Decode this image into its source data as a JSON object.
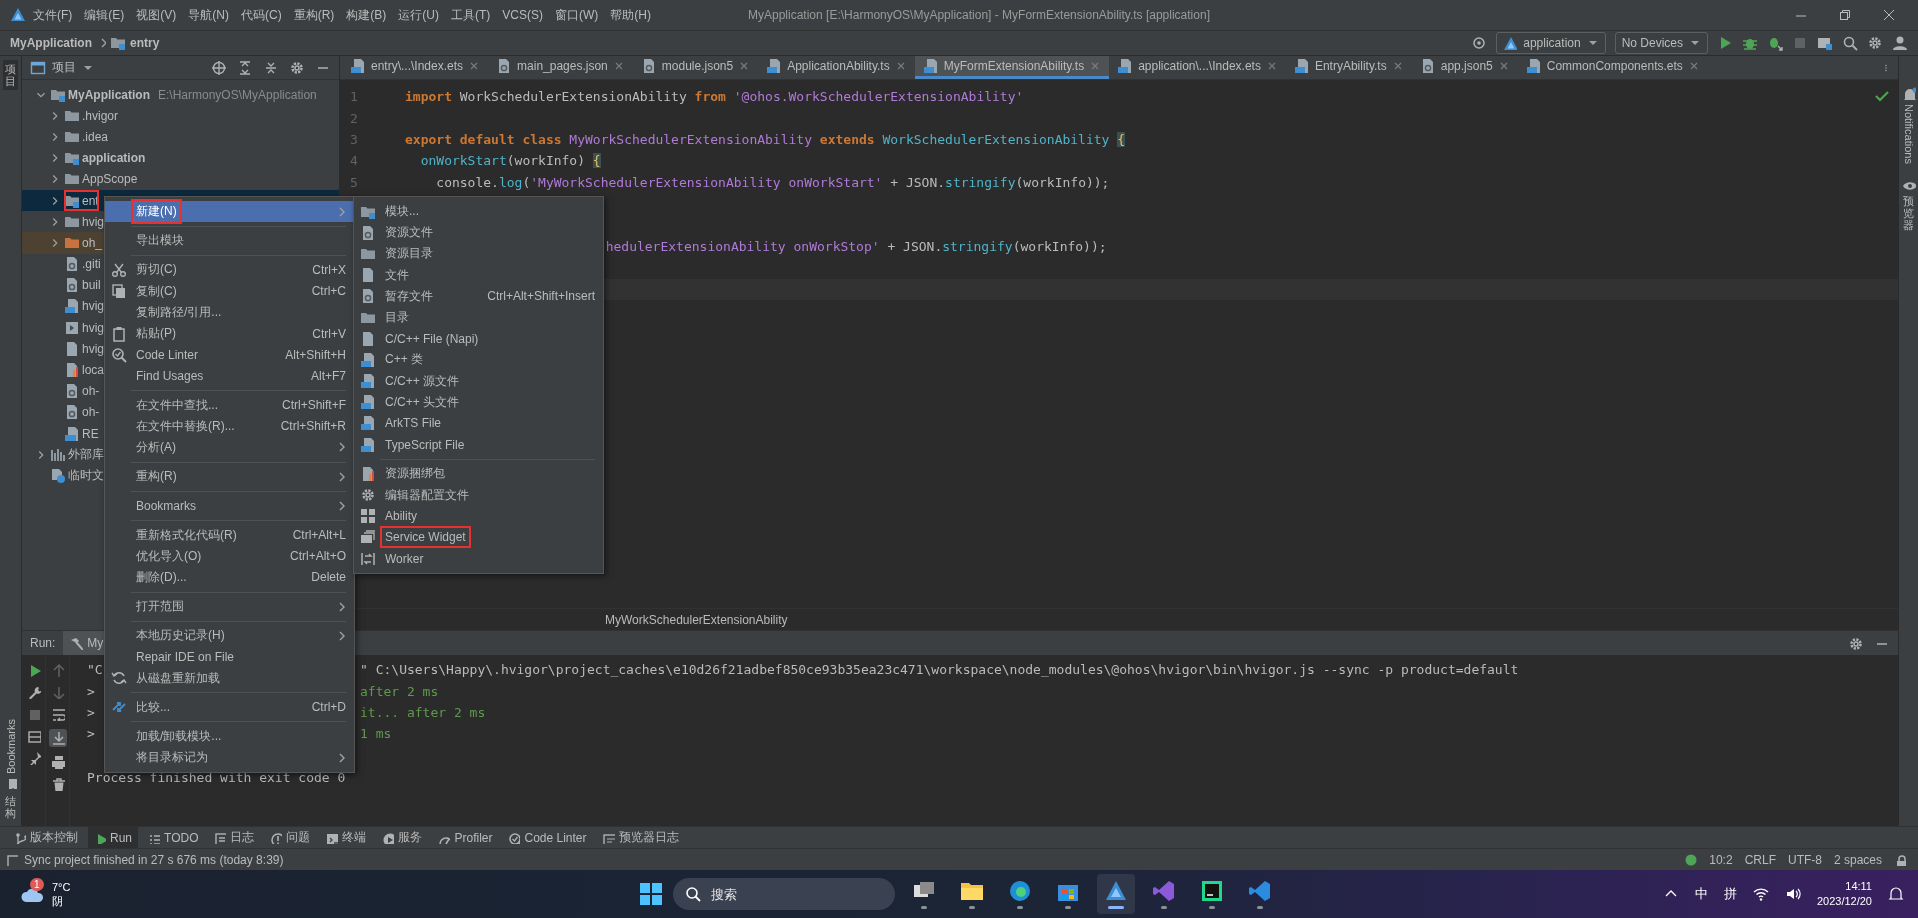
{
  "title_bar": {
    "menus": [
      "文件(F)",
      "编辑(E)",
      "视图(V)",
      "导航(N)",
      "代码(C)",
      "重构(R)",
      "构建(B)",
      "运行(U)",
      "工具(T)",
      "VCS(S)",
      "窗口(W)",
      "帮助(H)"
    ],
    "title": "MyApplication [E:\\HarmonyOS\\MyApplication] - MyFormExtensionAbility.ts [application]"
  },
  "nav_bar": {
    "breadcrumbs": [
      "MyApplication",
      "entry"
    ],
    "run_config": "application",
    "device": "No Devices"
  },
  "left_stripe": {
    "project": "项目",
    "bookmarks": "Bookmarks",
    "structure": "结构"
  },
  "right_stripe": {
    "notifications": "Notifications",
    "previewer": "预览器"
  },
  "project_panel": {
    "title": "项目",
    "tree": [
      {
        "label": "MyApplication",
        "path": "E:\\HarmonyOS\\MyApplication",
        "kind": "module",
        "bold": true,
        "expanded": true,
        "selected": false,
        "outlined": false,
        "children": [
          {
            "label": ".hvigor",
            "kind": "folder",
            "bold": false,
            "expanded": false,
            "selected": false,
            "outlined": false
          },
          {
            "label": ".idea",
            "kind": "folder",
            "bold": false,
            "expanded": false,
            "selected": false,
            "outlined": false
          },
          {
            "label": "application",
            "kind": "module",
            "bold": true,
            "expanded": false,
            "selected": false,
            "outlined": false
          },
          {
            "label": "AppScope",
            "kind": "folder",
            "bold": false,
            "expanded": false,
            "selected": false,
            "outlined": false
          },
          {
            "label": "ent",
            "kind": "module",
            "bold": false,
            "expanded": false,
            "selected": true,
            "outlined": true
          },
          {
            "label": "hvig",
            "kind": "folder",
            "bold": false,
            "expanded": false,
            "selected": false,
            "outlined": false
          },
          {
            "label": "oh_",
            "kind": "excluded-folder",
            "bold": false,
            "expanded": false,
            "selected": false,
            "outlined": false
          },
          {
            "label": ".giti",
            "kind": "config-file",
            "bold": false,
            "selected": false,
            "outlined": false
          },
          {
            "label": "buil",
            "kind": "config-file",
            "bold": false,
            "selected": false,
            "outlined": false
          },
          {
            "label": "hvig",
            "kind": "ts-file",
            "bold": false,
            "selected": false,
            "outlined": false
          },
          {
            "label": "hvig",
            "kind": "script-file",
            "bold": false,
            "selected": false,
            "outlined": false
          },
          {
            "label": "hvig",
            "kind": "text-file",
            "bold": false,
            "selected": false,
            "outlined": false
          },
          {
            "label": "loca",
            "kind": "chart-file",
            "bold": false,
            "selected": false,
            "outlined": false
          },
          {
            "label": "oh-",
            "kind": "config-file",
            "bold": false,
            "selected": false,
            "outlined": false
          },
          {
            "label": "oh-",
            "kind": "config-file",
            "bold": false,
            "selected": false,
            "outlined": false
          },
          {
            "label": "RE",
            "kind": "md-file",
            "bold": false,
            "selected": false,
            "outlined": false
          }
        ]
      },
      {
        "label": "外部库",
        "kind": "library",
        "bold": false,
        "expanded": false,
        "selected": false,
        "outlined": false
      },
      {
        "label": "临时文",
        "kind": "scratch",
        "bold": false,
        "selected": false,
        "outlined": false
      }
    ]
  },
  "editor": {
    "tabs": [
      {
        "label": "entry\\...\\Index.ets",
        "kind": "ets",
        "selected": false
      },
      {
        "label": "main_pages.json",
        "kind": "json",
        "selected": false
      },
      {
        "label": "module.json5",
        "kind": "json",
        "selected": false
      },
      {
        "label": "ApplicationAbility.ts",
        "kind": "ts",
        "selected": false
      },
      {
        "label": "MyFormExtensionAbility.ts",
        "kind": "ts",
        "selected": true
      },
      {
        "label": "application\\...\\Index.ets",
        "kind": "ets",
        "selected": false
      },
      {
        "label": "EntryAbility.ts",
        "kind": "ts",
        "selected": false
      },
      {
        "label": "app.json5",
        "kind": "json",
        "selected": false
      },
      {
        "label": "CommonComponents.ets",
        "kind": "ets",
        "selected": false
      }
    ],
    "lines": [
      {
        "kind": "full",
        "number": "1",
        "segments": [
          {
            "kind": "kw",
            "text": "import"
          },
          {
            "kind": "plain",
            "text": " WorkSchedulerExtensionAbility "
          },
          {
            "kind": "kw",
            "text": "from"
          },
          {
            "kind": "str",
            "text": " '@ohos.WorkSchedulerExtensionAbility'"
          }
        ]
      },
      {
        "kind": "full",
        "number": "2"
      },
      {
        "kind": "full",
        "number": "3",
        "segments": [
          {
            "kind": "kw",
            "text": "export default class"
          },
          {
            "kind": "cls",
            "text": " MyWorkSchedulerExtensionAbility "
          },
          {
            "kind": "kw",
            "text": "extends"
          },
          {
            "kind": "type",
            "text": " WorkSchedulerExtensionAbility "
          },
          {
            "kind": "brace",
            "text": "{"
          }
        ]
      },
      {
        "kind": "full",
        "number": "4",
        "segments": [
          {
            "kind": "fn",
            "text": "  onWorkStart"
          },
          {
            "kind": "plain",
            "text": "(workInfo) "
          },
          {
            "kind": "brace",
            "text": "{"
          }
        ]
      },
      {
        "kind": "full",
        "number": "5",
        "segments": [
          {
            "kind": "plain",
            "text": "    console."
          },
          {
            "kind": "fn",
            "text": "log"
          },
          {
            "kind": "plain",
            "text": "("
          },
          {
            "kind": "str",
            "text": "'MyWorkSchedulerExtensionAbility onWorkStart'"
          },
          {
            "kind": "plain",
            "text": " + JSON."
          },
          {
            "kind": "fn",
            "text": "stringify"
          },
          {
            "kind": "plain",
            "text": "(workInfo));"
          }
        ]
      },
      {
        "kind": "hidden"
      },
      {
        "kind": "hidden"
      },
      {
        "kind": "clipped",
        "segments": [
          {
            "kind": "str",
            "text": "hedulerExtensionAbility onWorkStop'"
          },
          {
            "kind": "plain",
            "text": " + JSON."
          },
          {
            "kind": "fn",
            "text": "stringify"
          },
          {
            "kind": "plain",
            "text": "(workInfo));"
          }
        ]
      },
      {
        "kind": "hidden"
      },
      {
        "kind": "caret"
      }
    ],
    "breadcrumb": "MyWorkSchedulerExtensionAbility"
  },
  "context_menu": {
    "items": [
      {
        "kind": "item",
        "label": "新建(N)",
        "submenu": true,
        "selected": true,
        "outlined": true
      },
      {
        "kind": "separator"
      },
      {
        "kind": "item",
        "label": "导出模块",
        "submenu": false,
        "selected": false,
        "outlined": false
      },
      {
        "kind": "separator"
      },
      {
        "kind": "item",
        "label": "剪切(C)",
        "shortcut": "Ctrl+X",
        "submenu": false,
        "selected": false,
        "outlined": false
      },
      {
        "kind": "item",
        "label": "复制(C)",
        "shortcut": "Ctrl+C",
        "submenu": false,
        "selected": false,
        "outlined": false
      },
      {
        "kind": "item",
        "label": "复制路径/引用...",
        "submenu": false,
        "selected": false,
        "outlined": false
      },
      {
        "kind": "item",
        "label": "粘贴(P)",
        "shortcut": "Ctrl+V",
        "submenu": false,
        "selected": false,
        "outlined": false
      },
      {
        "kind": "item",
        "label": "Code Linter",
        "shortcut": "Alt+Shift+H",
        "submenu": false,
        "selected": false,
        "outlined": false
      },
      {
        "kind": "item",
        "label": "Find Usages",
        "shortcut": "Alt+F7",
        "submenu": false,
        "selected": false,
        "outlined": false
      },
      {
        "kind": "separator"
      },
      {
        "kind": "item",
        "label": "在文件中查找...",
        "shortcut": "Ctrl+Shift+F",
        "submenu": false,
        "selected": false,
        "outlined": false
      },
      {
        "kind": "item",
        "label": "在文件中替换(R)...",
        "shortcut": "Ctrl+Shift+R",
        "submenu": false,
        "selected": false,
        "outlined": false
      },
      {
        "kind": "item",
        "label": "分析(A)",
        "submenu": true,
        "selected": false,
        "outlined": false
      },
      {
        "kind": "separator"
      },
      {
        "kind": "item",
        "label": "重构(R)",
        "submenu": true,
        "selected": false,
        "outlined": false
      },
      {
        "kind": "separator"
      },
      {
        "kind": "item",
        "label": "Bookmarks",
        "submenu": true,
        "selected": false,
        "outlined": false
      },
      {
        "kind": "separator"
      },
      {
        "kind": "item",
        "label": "重新格式化代码(R)",
        "shortcut": "Ctrl+Alt+L",
        "submenu": false,
        "selected": false,
        "outlined": false
      },
      {
        "kind": "item",
        "label": "优化导入(O)",
        "shortcut": "Ctrl+Alt+O",
        "submenu": false,
        "selected": false,
        "outlined": false
      },
      {
        "kind": "item",
        "label": "删除(D)...",
        "shortcut": "Delete",
        "submenu": false,
        "selected": false,
        "outlined": false
      },
      {
        "kind": "separator"
      },
      {
        "kind": "item",
        "label": "打开范围",
        "submenu": true,
        "selected": false,
        "outlined": false
      },
      {
        "kind": "separator"
      },
      {
        "kind": "item",
        "label": "本地历史记录(H)",
        "submenu": true,
        "selected": false,
        "outlined": false
      },
      {
        "kind": "item",
        "label": "Repair IDE on File",
        "submenu": false,
        "selected": false,
        "outlined": false
      },
      {
        "kind": "item",
        "label": "从磁盘重新加载",
        "submenu": false,
        "selected": false,
        "outlined": false
      },
      {
        "kind": "separator"
      },
      {
        "kind": "item",
        "label": "比较...",
        "shortcut": "Ctrl+D",
        "submenu": false,
        "selected": false,
        "outlined": false
      },
      {
        "kind": "separator"
      },
      {
        "kind": "item",
        "label": "加载/卸载模块...",
        "submenu": false,
        "selected": false,
        "outlined": false
      },
      {
        "kind": "item",
        "label": "将目录标记为",
        "submenu": true,
        "selected": false,
        "outlined": false
      }
    ]
  },
  "submenu": {
    "items": [
      {
        "kind": "item",
        "label": "模块...",
        "selected": false,
        "outlined": false
      },
      {
        "kind": "item",
        "label": "资源文件",
        "selected": false,
        "outlined": false
      },
      {
        "kind": "item",
        "label": "资源目录",
        "selected": false,
        "outlined": false
      },
      {
        "kind": "item",
        "label": "文件",
        "selected": false,
        "outlined": false
      },
      {
        "kind": "item",
        "label": "暂存文件",
        "shortcut": "Ctrl+Alt+Shift+Insert",
        "selected": false,
        "outlined": false
      },
      {
        "kind": "item",
        "label": "目录",
        "selected": false,
        "outlined": false
      },
      {
        "kind": "item",
        "label": "C/C++ File (Napi)",
        "selected": false,
        "outlined": false
      },
      {
        "kind": "item",
        "label": "C++ 类",
        "selected": false,
        "outlined": false
      },
      {
        "kind": "item",
        "label": "C/C++ 源文件",
        "selected": false,
        "outlined": false
      },
      {
        "kind": "item",
        "label": "C/C++ 头文件",
        "selected": false,
        "outlined": false
      },
      {
        "kind": "item",
        "label": "ArkTS File",
        "selected": false,
        "outlined": false
      },
      {
        "kind": "item",
        "label": "TypeScript File",
        "selected": false,
        "outlined": false
      },
      {
        "kind": "separator"
      },
      {
        "kind": "item",
        "label": "资源捆绑包",
        "selected": false,
        "outlined": false
      },
      {
        "kind": "item",
        "label": "编辑器配置文件",
        "selected": false,
        "outlined": false
      },
      {
        "kind": "item",
        "label": "Ability",
        "selected": false,
        "outlined": false
      },
      {
        "kind": "item",
        "label": "Service Widget",
        "selected": false,
        "outlined": true
      },
      {
        "kind": "item",
        "label": "Worker",
        "selected": false,
        "outlined": false
      }
    ]
  },
  "run_panel": {
    "label": "Run:",
    "tab": "My",
    "scroll_to_end": true,
    "lines": [
      {
        "kind": "command",
        "lead": "\"C",
        "text": "\" C:\\Users\\Happy\\.hvigor\\project_caches\\e10d26f21adbef850ce93b35ea23c471\\workspace\\node_modules\\@ohos\\hvigor\\bin\\hvigor.js --sync -p product=default"
      },
      {
        "kind": "step",
        "lead": ">",
        "text": "after 2 ms"
      },
      {
        "kind": "step",
        "lead": ">",
        "text": "it... after 2 ms"
      },
      {
        "kind": "step",
        "lead": ">",
        "text": "1 ms"
      },
      {
        "kind": "summary",
        "lead": "Process finished with exit code 0"
      }
    ]
  },
  "tool_windows": [
    {
      "label": "版本控制",
      "selected": false
    },
    {
      "label": "Run",
      "selected": true
    },
    {
      "label": "TODO",
      "selected": false
    },
    {
      "label": "日志",
      "selected": false
    },
    {
      "label": "问题",
      "selected": false
    },
    {
      "label": "终端",
      "selected": false
    },
    {
      "label": "服务",
      "selected": false
    },
    {
      "label": "Profiler",
      "selected": false
    },
    {
      "label": "Code Linter",
      "selected": false
    },
    {
      "label": "预览器日志",
      "selected": false
    }
  ],
  "status_bar": {
    "message": "Sync project finished in 27 s 676 ms (today 8:39)",
    "position": "10:2",
    "line_ending": "CRLF",
    "encoding": "UTF-8",
    "indent": "2 spaces"
  },
  "taskbar": {
    "weather_badge": "1",
    "temperature": "7°C",
    "condition": "阴",
    "search_placeholder": "搜索",
    "apps": [
      {
        "selected": false
      },
      {
        "selected": false
      },
      {
        "selected": false
      },
      {
        "selected": false
      },
      {
        "selected": true
      },
      {
        "selected": false
      },
      {
        "selected": false
      },
      {
        "selected": false
      }
    ],
    "ime": "中",
    "ime_mode": "拼",
    "time": "14:11",
    "date": "2023/12/20"
  }
}
